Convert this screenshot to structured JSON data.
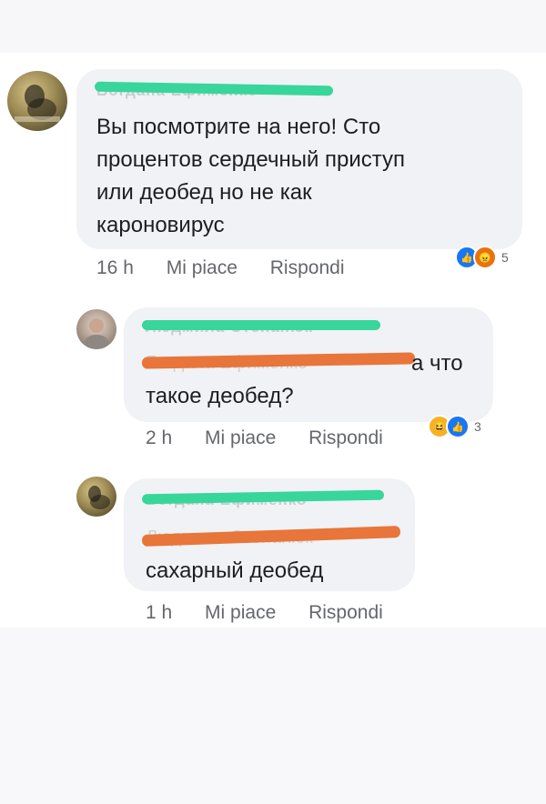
{
  "comments": [
    {
      "author": "Богдана Ефименко",
      "text": "Вы посмотрите на него! Сто\nпроцентов сердечный приступ\nили деобед но не как\nкароновирус",
      "time": "16 h",
      "like_label": "Mi piace",
      "reply_label": "Rispondi",
      "reactions": [
        "like-icon",
        "angry-icon"
      ],
      "reaction_count": "5"
    },
    {
      "author": "Людмила Степанюк",
      "mention": "Богдана Ефименко",
      "text": "а что\nтакое деобед?",
      "time": "2 h",
      "like_label": "Mi piace",
      "reply_label": "Rispondi",
      "reactions": [
        "haha-icon",
        "like-icon"
      ],
      "reaction_count": "3"
    },
    {
      "author": "Богдана Ефименко",
      "mention": "Людмила Степанюк",
      "text": "сахарный деобед",
      "time": "1 h",
      "like_label": "Mi piace",
      "reply_label": "Rispondi"
    }
  ],
  "colors": {
    "bubble": "#f0f2f5",
    "scribble_green": "#38d69b",
    "scribble_orange": "#e8753a",
    "like": "#1877f2",
    "angry": "#e9710f",
    "haha": "#f7b125"
  }
}
